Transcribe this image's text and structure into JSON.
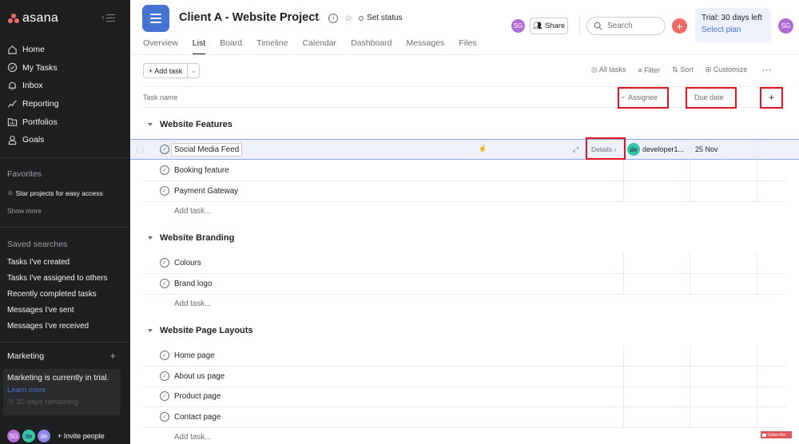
{
  "sidebar": {
    "brand": "asana",
    "nav": [
      {
        "label": "Home",
        "icon": "home-icon"
      },
      {
        "label": "My Tasks",
        "icon": "check-circle-icon"
      },
      {
        "label": "Inbox",
        "icon": "bell-icon"
      },
      {
        "label": "Reporting",
        "icon": "chart-line-icon"
      },
      {
        "label": "Portfolios",
        "icon": "folder-icon"
      },
      {
        "label": "Goals",
        "icon": "person-icon"
      }
    ],
    "favorites_title": "Favorites",
    "favorites_hint": "Star projects for easy access",
    "show_more": "Show more",
    "saved_title": "Saved searches",
    "saved": [
      "Tasks I've created",
      "Tasks I've assigned to others",
      "Recently completed tasks",
      "Messages I've sent",
      "Messages I've received"
    ],
    "team": "Marketing",
    "trial_text": "Marketing is currently in trial.",
    "learn_more": "Learn more",
    "days_remaining": "30 days remaining",
    "avatars": [
      "SG",
      "de",
      "de"
    ],
    "invite": "+ Invite people"
  },
  "header": {
    "project_title": "Client A - Website Project",
    "set_status": "Set status",
    "tabs": [
      "Overview",
      "List",
      "Board",
      "Timeline",
      "Calendar",
      "Dashboard",
      "Messages",
      "Files"
    ],
    "active_tab": "List",
    "member_avatar": "SG",
    "share": "Share",
    "search_placeholder": "Search",
    "trial": "Trial: 30 days left",
    "select_plan": "Select plan",
    "user_avatar": "SG"
  },
  "toolbar": {
    "add_task": "+ Add task",
    "all_tasks": "All tasks",
    "filter": "Filter",
    "sort": "Sort",
    "customize": "Customize"
  },
  "columns": {
    "task_name": "Task name",
    "assignee": "Assignee",
    "due_date": "Due date",
    "add_column": "+"
  },
  "sections": [
    {
      "title": "Website Features",
      "tasks": [
        "Social Media Feed",
        "Booking feature",
        "Payment Gateway"
      ]
    },
    {
      "title": "Website Branding",
      "tasks": [
        "Colours",
        "Brand logo"
      ]
    },
    {
      "title": "Website Page Layouts",
      "tasks": [
        "Home page",
        "About us page",
        "Product page",
        "Contact page"
      ]
    }
  ],
  "selected_task": {
    "details": "Details ›",
    "assignee_initials": "de",
    "assignee_name": "developer1...",
    "due": "25 Nov"
  },
  "add_task_row": "Add task...",
  "subscribe_badge": "Subscribe"
}
